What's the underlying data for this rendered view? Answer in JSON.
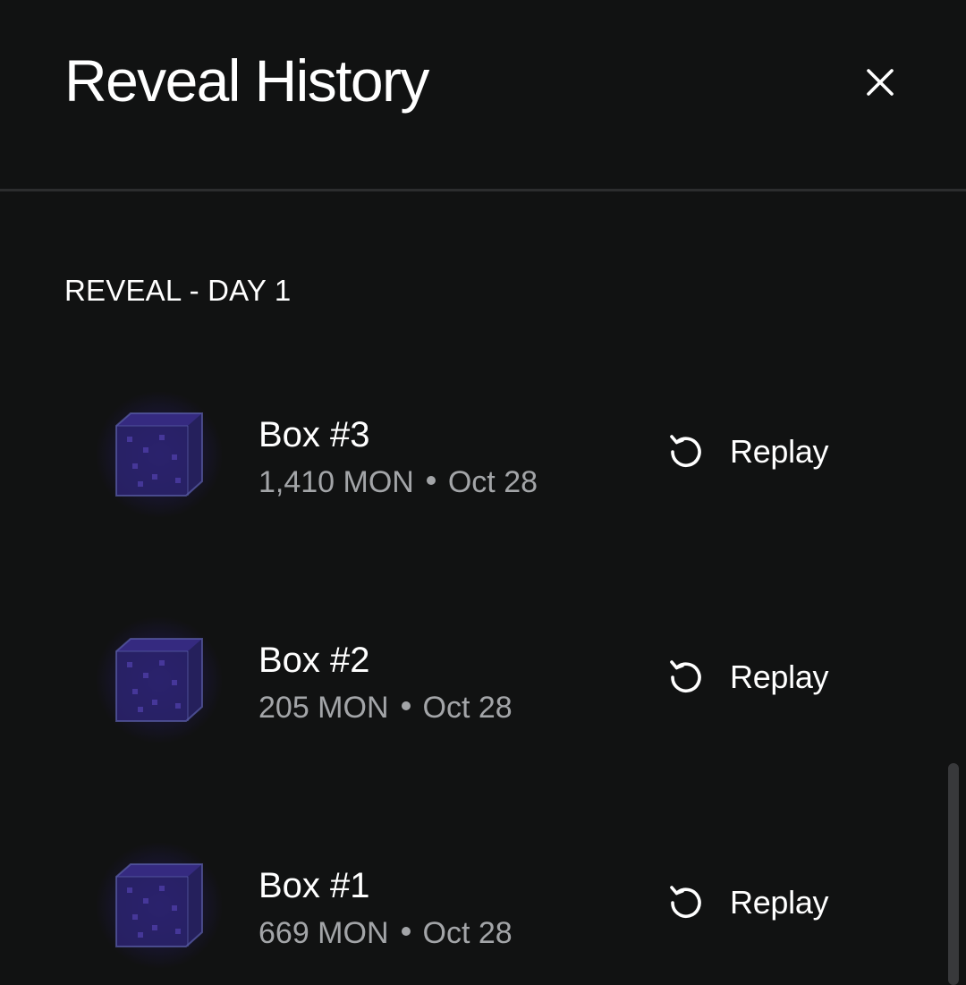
{
  "header": {
    "title": "Reveal History",
    "close_icon": "close-icon"
  },
  "section": {
    "label": "REVEAL - DAY 1"
  },
  "items": [
    {
      "name": "Box #3",
      "amount": "1,410 MON",
      "date": "Oct 28",
      "action_label": "Replay",
      "action_icon": "replay-icon",
      "thumb_icon": "box-icon"
    },
    {
      "name": "Box #2",
      "amount": "205 MON",
      "date": "Oct 28",
      "action_label": "Replay",
      "action_icon": "replay-icon",
      "thumb_icon": "box-icon"
    },
    {
      "name": "Box #1",
      "amount": "669 MON",
      "date": "Oct 28",
      "action_label": "Replay",
      "action_icon": "replay-icon",
      "thumb_icon": "box-icon"
    }
  ],
  "colors": {
    "background": "#111212",
    "text_primary": "#ffffff",
    "text_secondary": "#a3a5a8",
    "divider": "#2c2d2e",
    "box_glow": "#3426a0"
  }
}
